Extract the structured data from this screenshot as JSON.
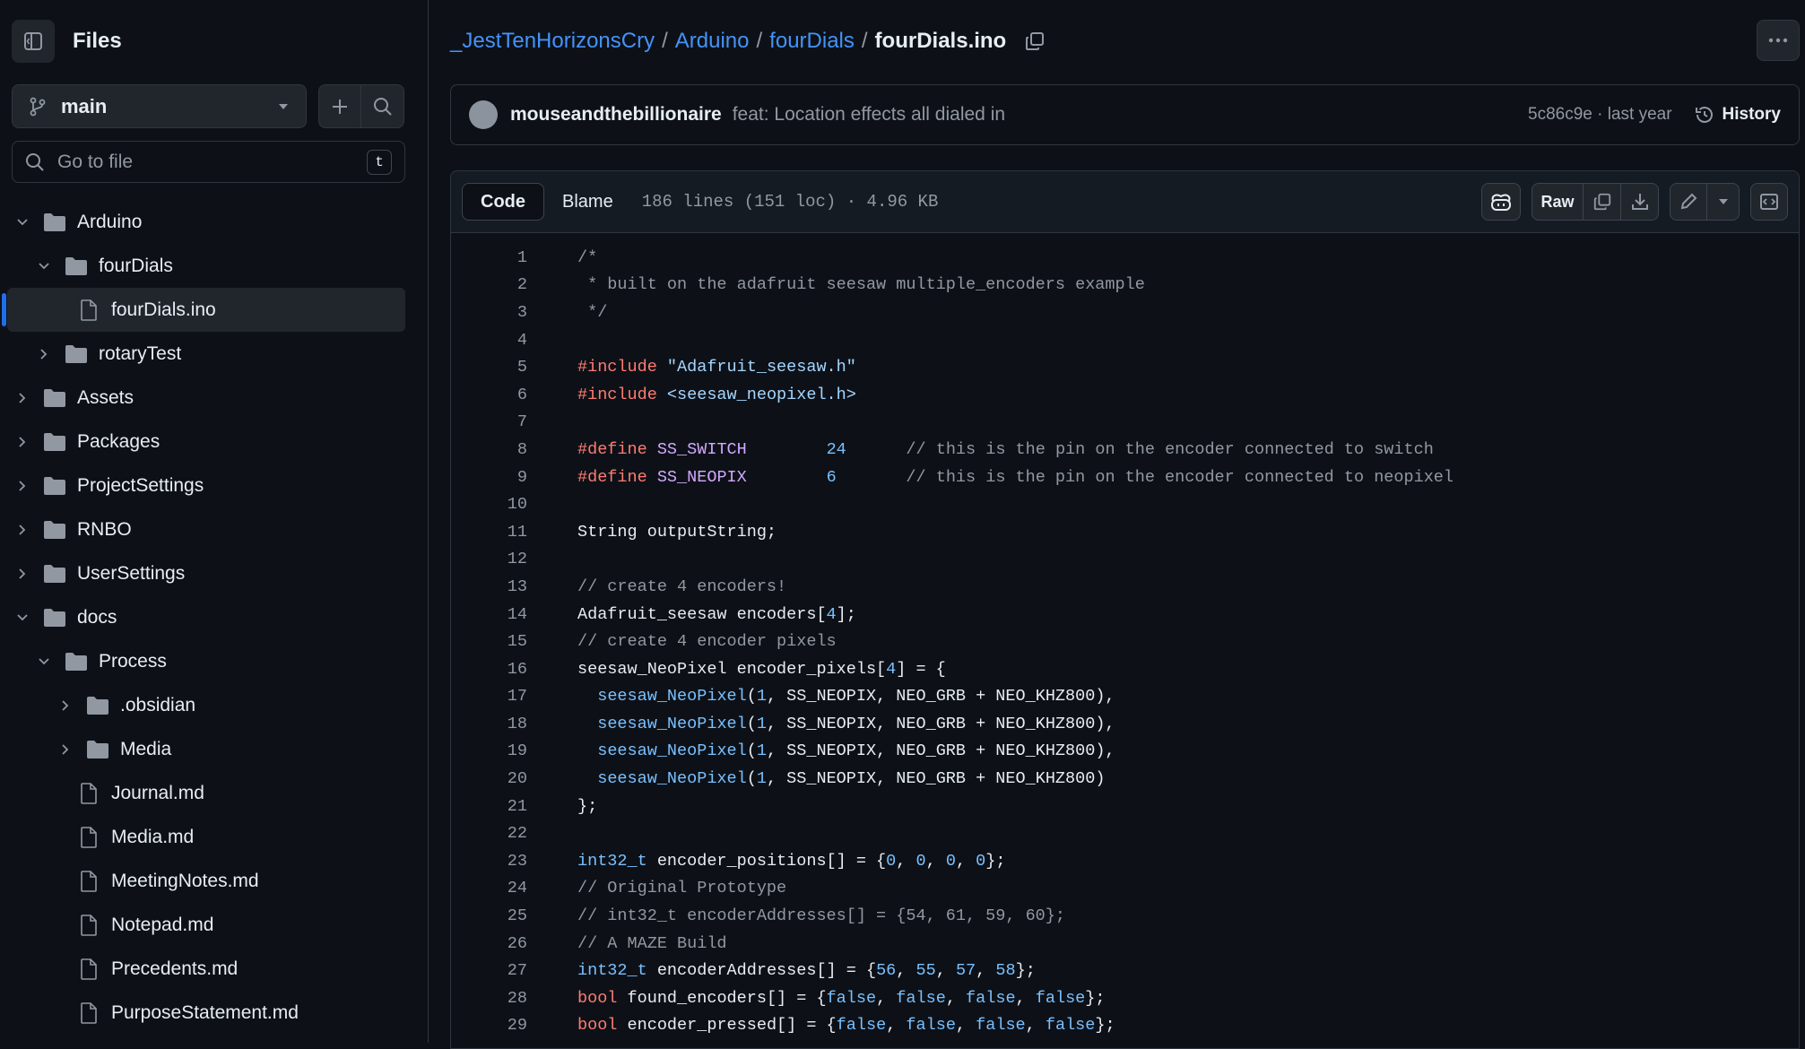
{
  "sidebar": {
    "title": "Files",
    "branch": "main",
    "goto_placeholder": "Go to file",
    "goto_shortcut": "t",
    "tree": [
      {
        "label": "Arduino",
        "type": "folder",
        "depth": 0,
        "expanded": true
      },
      {
        "label": "fourDials",
        "type": "folder",
        "depth": 1,
        "expanded": true
      },
      {
        "label": "fourDials.ino",
        "type": "file",
        "depth": 2,
        "selected": true
      },
      {
        "label": "rotaryTest",
        "type": "folder",
        "depth": 1,
        "expanded": false
      },
      {
        "label": "Assets",
        "type": "folder",
        "depth": 0,
        "expanded": false
      },
      {
        "label": "Packages",
        "type": "folder",
        "depth": 0,
        "expanded": false
      },
      {
        "label": "ProjectSettings",
        "type": "folder",
        "depth": 0,
        "expanded": false
      },
      {
        "label": "RNBO",
        "type": "folder",
        "depth": 0,
        "expanded": false
      },
      {
        "label": "UserSettings",
        "type": "folder",
        "depth": 0,
        "expanded": false
      },
      {
        "label": "docs",
        "type": "folder",
        "depth": 0,
        "expanded": true
      },
      {
        "label": "Process",
        "type": "folder",
        "depth": 1,
        "expanded": true
      },
      {
        "label": ".obsidian",
        "type": "folder",
        "depth": 2,
        "expanded": false
      },
      {
        "label": "Media",
        "type": "folder",
        "depth": 2,
        "expanded": false
      },
      {
        "label": "Journal.md",
        "type": "file",
        "depth": 2
      },
      {
        "label": "Media.md",
        "type": "file",
        "depth": 2
      },
      {
        "label": "MeetingNotes.md",
        "type": "file",
        "depth": 2
      },
      {
        "label": "Notepad.md",
        "type": "file",
        "depth": 2
      },
      {
        "label": "Precedents.md",
        "type": "file",
        "depth": 2
      },
      {
        "label": "PurposeStatement.md",
        "type": "file",
        "depth": 2
      }
    ]
  },
  "breadcrumb": {
    "repo": "_JestTenHorizonsCry",
    "dir1": "Arduino",
    "dir2": "fourDials",
    "file": "fourDials.ino",
    "sep": "/"
  },
  "commit": {
    "author": "mouseandthebillionaire",
    "message": "feat: Location effects all dialed in",
    "sha_time": "5c86c9e · last year",
    "history_label": "History"
  },
  "file": {
    "tab_code": "Code",
    "tab_blame": "Blame",
    "meta": "186 lines (151 loc) · 4.96 KB",
    "raw_label": "Raw"
  },
  "code_lines": [
    [
      [
        "cm",
        "/*"
      ]
    ],
    [
      [
        "cm",
        " * built on the adafruit seesaw multiple_encoders example"
      ]
    ],
    [
      [
        "cm",
        " */"
      ]
    ],
    [],
    [
      [
        "kw",
        "#include "
      ],
      [
        "str",
        "\"Adafruit_seesaw.h\""
      ]
    ],
    [
      [
        "kw",
        "#include "
      ],
      [
        "str",
        "<seesaw_neopixel.h>"
      ]
    ],
    [],
    [
      [
        "kw",
        "#define "
      ],
      [
        "mac",
        "SS_SWITCH"
      ],
      [
        "tx",
        "        "
      ],
      [
        "num",
        "24"
      ],
      [
        "tx",
        "      "
      ],
      [
        "cm",
        "// this is the pin on the encoder connected to switch"
      ]
    ],
    [
      [
        "kw",
        "#define "
      ],
      [
        "mac",
        "SS_NEOPIX"
      ],
      [
        "tx",
        "        "
      ],
      [
        "num",
        "6"
      ],
      [
        "tx",
        "       "
      ],
      [
        "cm",
        "// this is the pin on the encoder connected to neopixel"
      ]
    ],
    [],
    [
      [
        "tx",
        "String outputString;"
      ]
    ],
    [],
    [
      [
        "cm",
        "// create 4 encoders!"
      ]
    ],
    [
      [
        "tx",
        "Adafruit_seesaw encoders["
      ],
      [
        "num",
        "4"
      ],
      [
        "tx",
        "];"
      ]
    ],
    [
      [
        "cm",
        "// create 4 encoder pixels"
      ]
    ],
    [
      [
        "tx",
        "seesaw_NeoPixel encoder_pixels["
      ],
      [
        "num",
        "4"
      ],
      [
        "tx",
        "] = {"
      ]
    ],
    [
      [
        "tx",
        "  "
      ],
      [
        "fn",
        "seesaw_NeoPixel"
      ],
      [
        "tx",
        "("
      ],
      [
        "num",
        "1"
      ],
      [
        "tx",
        ", SS_NEOPIX, NEO_GRB + NEO_KHZ800),"
      ]
    ],
    [
      [
        "tx",
        "  "
      ],
      [
        "fn",
        "seesaw_NeoPixel"
      ],
      [
        "tx",
        "("
      ],
      [
        "num",
        "1"
      ],
      [
        "tx",
        ", SS_NEOPIX, NEO_GRB + NEO_KHZ800),"
      ]
    ],
    [
      [
        "tx",
        "  "
      ],
      [
        "fn",
        "seesaw_NeoPixel"
      ],
      [
        "tx",
        "("
      ],
      [
        "num",
        "1"
      ],
      [
        "tx",
        ", SS_NEOPIX, NEO_GRB + NEO_KHZ800),"
      ]
    ],
    [
      [
        "tx",
        "  "
      ],
      [
        "fn",
        "seesaw_NeoPixel"
      ],
      [
        "tx",
        "("
      ],
      [
        "num",
        "1"
      ],
      [
        "tx",
        ", SS_NEOPIX, NEO_GRB + NEO_KHZ800)"
      ]
    ],
    [
      [
        "tx",
        "};"
      ]
    ],
    [],
    [
      [
        "fn",
        "int32_t"
      ],
      [
        "tx",
        " encoder_positions[] = {"
      ],
      [
        "num",
        "0"
      ],
      [
        "tx",
        ", "
      ],
      [
        "num",
        "0"
      ],
      [
        "tx",
        ", "
      ],
      [
        "num",
        "0"
      ],
      [
        "tx",
        ", "
      ],
      [
        "num",
        "0"
      ],
      [
        "tx",
        "};"
      ]
    ],
    [
      [
        "cm",
        "// Original Prototype"
      ]
    ],
    [
      [
        "cm",
        "// int32_t encoderAddresses[] = {54, 61, 59, 60};"
      ]
    ],
    [
      [
        "cm",
        "// A MAZE Build"
      ]
    ],
    [
      [
        "fn",
        "int32_t"
      ],
      [
        "tx",
        " encoderAddresses[] = {"
      ],
      [
        "num",
        "56"
      ],
      [
        "tx",
        ", "
      ],
      [
        "num",
        "55"
      ],
      [
        "tx",
        ", "
      ],
      [
        "num",
        "57"
      ],
      [
        "tx",
        ", "
      ],
      [
        "num",
        "58"
      ],
      [
        "tx",
        "};"
      ]
    ],
    [
      [
        "kw",
        "bool"
      ],
      [
        "tx",
        " found_encoders[] = {"
      ],
      [
        "num",
        "false"
      ],
      [
        "tx",
        ", "
      ],
      [
        "num",
        "false"
      ],
      [
        "tx",
        ", "
      ],
      [
        "num",
        "false"
      ],
      [
        "tx",
        ", "
      ],
      [
        "num",
        "false"
      ],
      [
        "tx",
        "};"
      ]
    ],
    [
      [
        "kw",
        "bool"
      ],
      [
        "tx",
        " encoder_pressed[] = {"
      ],
      [
        "num",
        "false"
      ],
      [
        "tx",
        ", "
      ],
      [
        "num",
        "false"
      ],
      [
        "tx",
        ", "
      ],
      [
        "num",
        "false"
      ],
      [
        "tx",
        ", "
      ],
      [
        "num",
        "false"
      ],
      [
        "tx",
        "};"
      ]
    ]
  ],
  "colors": {
    "background": "#0d1117",
    "link": "#4493f8",
    "accent": "#1f6feb",
    "comment": "#9198a1",
    "keyword": "#ff7b72",
    "string": "#a5d6ff",
    "number": "#79c0ff",
    "entity": "#d2a8ff"
  },
  "icons": [
    "sidebar-toggle-icon",
    "branch-icon",
    "caret-down-icon",
    "plus-icon",
    "search-icon",
    "chevron-down-icon",
    "chevron-right-icon",
    "folder-icon",
    "file-icon",
    "copy-icon",
    "kebab-icon",
    "history-icon",
    "copilot-icon",
    "download-icon",
    "pencil-icon",
    "symbols-icon"
  ]
}
